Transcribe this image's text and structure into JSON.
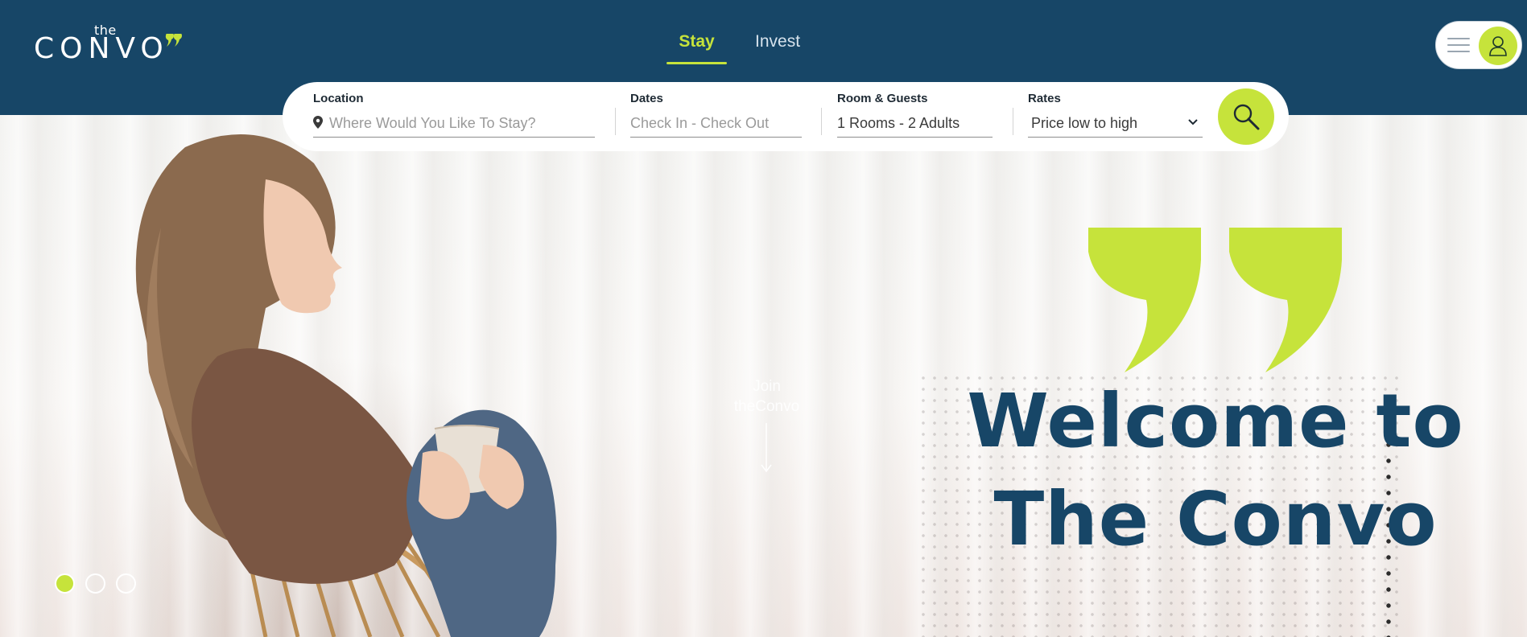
{
  "logo": {
    "prefix": "the",
    "word": "CONVO"
  },
  "nav": {
    "tabs": [
      {
        "label": "Stay",
        "active": true
      },
      {
        "label": "Invest",
        "active": false
      }
    ]
  },
  "search": {
    "location": {
      "label": "Location",
      "placeholder": "Where Would You Like To Stay?"
    },
    "dates": {
      "label": "Dates",
      "placeholder": "Check In - Check Out"
    },
    "rooms": {
      "label": "Room & Guests",
      "value": "1 Rooms - 2 Adults"
    },
    "rates": {
      "label": "Rates",
      "value": "Price low to high"
    }
  },
  "hero": {
    "join_text": "Join theConvo",
    "headline_line1": "Welcome to",
    "headline_line2": "The Convo"
  },
  "carousel": {
    "count": 3,
    "active_index": 0
  },
  "icons": {
    "menu": "hamburger-menu-icon",
    "user": "user-icon",
    "search": "magnifier-icon",
    "location": "map-pin-icon",
    "dropdown": "chevron-down-icon",
    "brand_quote": "quote-mark-icon"
  },
  "colors": {
    "header_bg": "#174667",
    "accent": "#c6e33b",
    "headline": "#174667",
    "white": "#ffffff"
  }
}
